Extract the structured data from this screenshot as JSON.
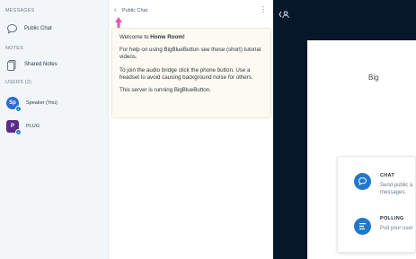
{
  "sidebar": {
    "messages_title": "MESSAGES",
    "public_chat_label": "Public Chat",
    "notes_title": "NOTES",
    "shared_notes_label": "Shared Notes",
    "users_title": "USERS (2)",
    "users": [
      {
        "initials": "Sp",
        "name": "Speaker (You)",
        "color": "#2e6ad0"
      },
      {
        "initials": "P",
        "name": "PLUG",
        "color": "#5a2a8c"
      }
    ]
  },
  "chat": {
    "title": "Public Chat",
    "welcome_prefix": "Welcome to ",
    "welcome_room": "Home Room!",
    "help_text": "For help on using BigBlueButton see these (short) tutorial videos.",
    "audio_text": "To join the audio bridge click the phone button. Use a headset to avoid causing background noise for others.",
    "server_text": "This server is running BigBlueButton."
  },
  "presentation": {
    "slide_title": "Big",
    "features": [
      {
        "icon": "chat-icon",
        "title": "CHAT",
        "desc_line1": "Send public a",
        "desc_line2": "messages."
      },
      {
        "icon": "polling-icon",
        "title": "POLLING",
        "desc_line1": "Poll your user",
        "desc_line2": ""
      }
    ]
  },
  "colors": {
    "accent": "#2277cc",
    "presentation_bg": "#06172a",
    "arrow": "#f04fb3"
  }
}
